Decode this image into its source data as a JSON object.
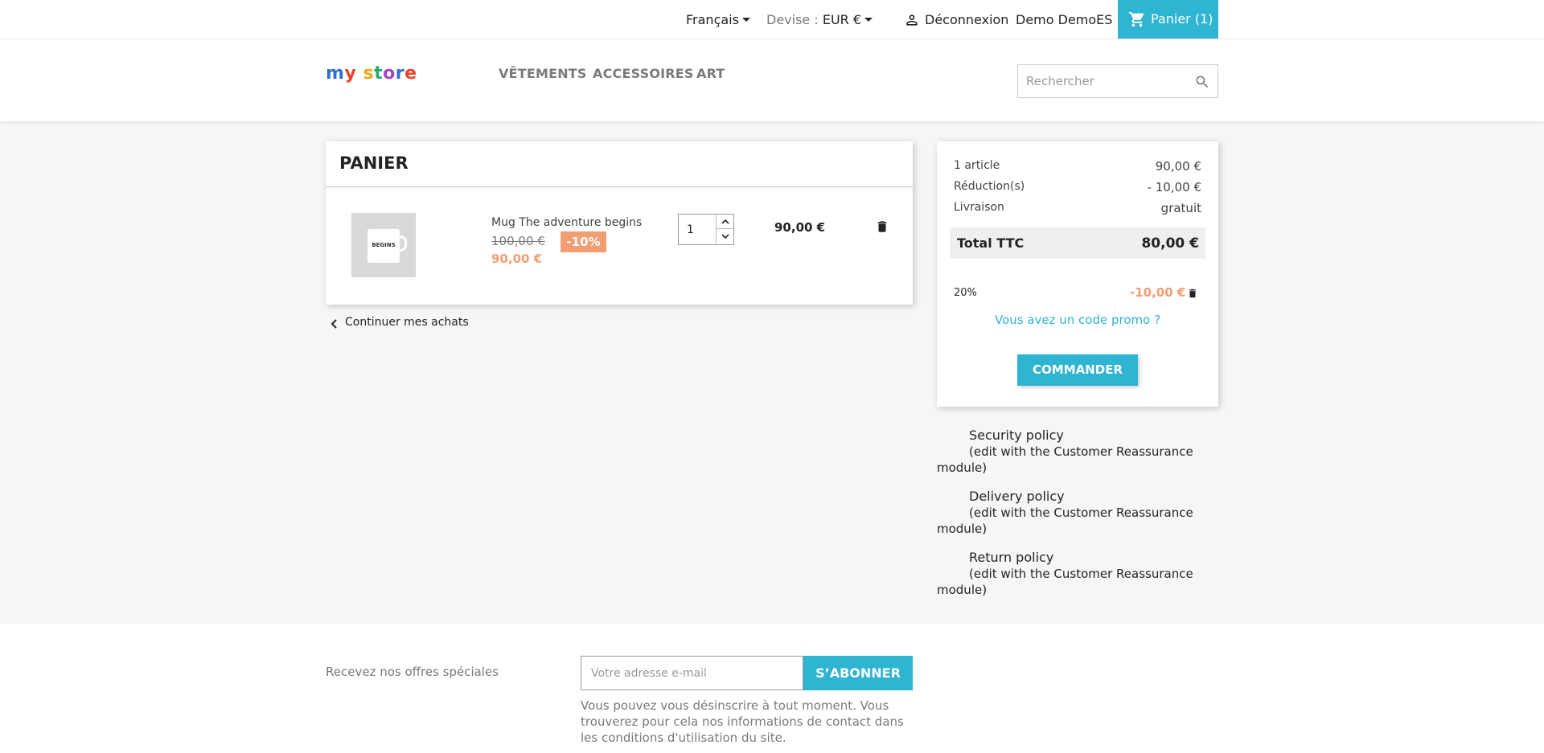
{
  "topbar": {
    "language": "Français",
    "currency_label": "Devise :",
    "currency_value": "EUR €",
    "logout": "Déconnexion",
    "username": "Demo DemoES",
    "cart": "Panier (1)"
  },
  "header": {
    "logo": "my store",
    "menu": [
      "VÊTEMENTS",
      "ACCESSOIRES",
      "ART"
    ],
    "search_placeholder": "Rechercher"
  },
  "cart": {
    "title": "PANIER",
    "item": {
      "name": "Mug The adventure begins",
      "old_price": "100,00 €",
      "discount": "-10%",
      "price": "90,00 €",
      "quantity": "1",
      "line_total": "90,00 €",
      "image_text": "BEGINS"
    },
    "continue": "Continuer mes achats"
  },
  "summary": {
    "rows": [
      {
        "label": "1 article",
        "value": "90,00 €"
      },
      {
        "label": "Réduction(s)",
        "value": "- 10,00 €"
      },
      {
        "label": "Livraison",
        "value": "gratuit"
      }
    ],
    "total_label": "Total TTC",
    "total_value": "80,00 €",
    "voucher_name": "20%",
    "voucher_value": "-10,00 €",
    "promo_link": "Vous avez un code promo ?",
    "order_button": "COMMANDER"
  },
  "reassurance": [
    {
      "title": "Security policy",
      "desc_line1": "(edit with the Customer Reassurance",
      "desc_line2": "module)"
    },
    {
      "title": "Delivery policy",
      "desc_line1": "(edit with the Customer Reassurance",
      "desc_line2": "module)"
    },
    {
      "title": "Return policy",
      "desc_line1": "(edit with the Customer Reassurance",
      "desc_line2": "module)"
    }
  ],
  "newsletter": {
    "title": "Recevez nos offres spéciales",
    "placeholder": "Votre adresse e-mail",
    "button": "S’ABONNER",
    "note": "Vous pouvez vous désinscrire à tout moment. Vous trouverez pour cela nos informations de contact dans les conditions d'utilisation du site."
  },
  "colors": {
    "accent": "#2fb5d2",
    "discount": "#f39d72"
  }
}
